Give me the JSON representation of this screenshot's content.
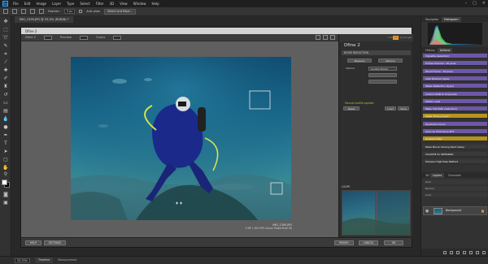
{
  "menubar": {
    "logo": "Ps",
    "items": [
      "File",
      "Edit",
      "Image",
      "Layer",
      "Type",
      "Select",
      "Filter",
      "3D",
      "View",
      "Window",
      "Help"
    ]
  },
  "options": {
    "feather_label": "Feather:",
    "feather_value": "0 px",
    "antialias_label": "Anti-alias",
    "select_mask_label": "Select and Mask..."
  },
  "document": {
    "tab_label": "IMG_1395.JPG @ 33,3% (RGB/8) *"
  },
  "dfine": {
    "window_title": "Dfine 2",
    "toolbar": {
      "view_label": "Dfine 2",
      "preview_label": "Preview",
      "colors_label": "Colors"
    },
    "brand_badge": "nik",
    "brand_text": "Collection by Google",
    "product_name": "Dfine 2",
    "section_noise": "NOISE REDUCTION",
    "measure_button": "Measure",
    "reduce_button": "Reduce",
    "method_label": "Method",
    "method_value": "Control Points",
    "status_message": "Manual profile applied",
    "reset_button": "Reset",
    "load_button": "Load",
    "save_button": "Save",
    "loupe_title": "LOUPE",
    "caption_file": "IMG_1395.JPG",
    "caption_detail": "3 MP | 300 DPI Canon PowerShot SX",
    "help_button": "HELP",
    "settings_button": "SETTINGS",
    "brush_button": "BRUSH",
    "cancel_button": "CANCEL",
    "ok_button": "OK"
  },
  "right_panel": {
    "tab_navigator": "Navigator",
    "tab_histogram": "Histogram",
    "tab_history": "History",
    "tab_actions": "Actions",
    "actions": [
      {
        "label": "Vignette (selection)",
        "color": "#6e57a8"
      },
      {
        "label": "Frame Channel - 50 pixel",
        "color": "#6e57a8"
      },
      {
        "label": "Wood Frame - 50 pixel",
        "color": "#6e57a8"
      },
      {
        "label": "Cast Shadow (type)",
        "color": "#6e57a8"
      },
      {
        "label": "Water Reflection (type)",
        "color": "#6e57a8"
      },
      {
        "label": "Custom RGB to Grayscale",
        "color": "#6e57a8"
      },
      {
        "label": "Molten Lead",
        "color": "#6e57a8"
      },
      {
        "label": "Make Clip Path (selection)",
        "color": "#6e57a8"
      },
      {
        "label": "Sepia Toning (layer)",
        "color": "#b6931e"
      },
      {
        "label": "Quadrant Colors",
        "color": "#6e57a8"
      },
      {
        "label": "Save As Photoshop PDF",
        "color": "#6e57a8"
      },
      {
        "label": "Gradient Map",
        "color": "#b6931e"
      },
      {
        "label": "Mixer Brush Cloning Paint Setup",
        "color": "#3a3a3a"
      },
      {
        "label": "Chart/Fill for INFRARED",
        "color": "#3a3a3a"
      },
      {
        "label": "Sharpen High Pass Method",
        "color": "#3a3a3a"
      }
    ],
    "tab_layers": "Layers",
    "tab_channels": "Channels",
    "tab_paths": "3D",
    "layer_kind": "Kind",
    "layer_blend": "Normal",
    "layer_lock": "Lock:",
    "layer_name": "Background"
  },
  "statusbar": {
    "zoom": "33,33%",
    "tab_timeline": "Timeline",
    "tab_measurement": "Measurement"
  },
  "colors": {
    "accent_green": "#9ccc3c",
    "nik_orange": "#e89a2a",
    "action_purple": "#6e57a8",
    "action_gold": "#b6931e"
  }
}
